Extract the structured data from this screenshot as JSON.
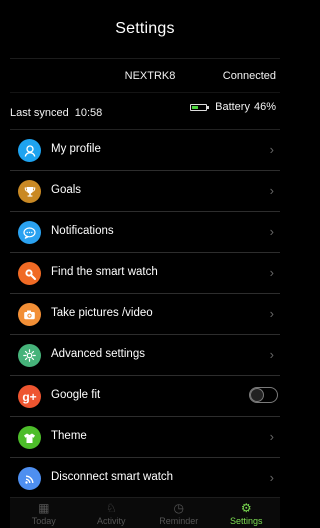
{
  "header": {
    "title": "Settings"
  },
  "device": {
    "name": "NEXTRK8",
    "status": "Connected"
  },
  "sync": {
    "label": "Last synced",
    "time": "10:58"
  },
  "battery": {
    "label": "Battery",
    "value": "46%",
    "level": 0.46
  },
  "menu": {
    "items": [
      {
        "label": "My profile",
        "icon": "profile-icon",
        "color": "#1ea3f0"
      },
      {
        "label": "Goals",
        "icon": "trophy-icon",
        "color": "#c98924"
      },
      {
        "label": "Notifications",
        "icon": "chat-icon",
        "color": "#2aa2f1"
      },
      {
        "label": "Find the smart watch",
        "icon": "search-icon",
        "color": "#f06a24"
      },
      {
        "label": "Take pictures /video",
        "icon": "camera-icon",
        "color": "#f28f36"
      },
      {
        "label": "Advanced settings",
        "icon": "gear-icon",
        "color": "#46b37a"
      },
      {
        "label": "Google fit",
        "icon": "google-plus-icon",
        "color": "#ee5530"
      },
      {
        "label": "Theme",
        "icon": "shirt-icon",
        "color": "#4dbd2a"
      },
      {
        "label": "Disconnect smart watch",
        "icon": "wifi-icon",
        "color": "#4e8ff0"
      }
    ]
  },
  "toggle": {
    "google_fit_enabled": false
  },
  "bottom_nav": {
    "items": [
      {
        "label": "Today",
        "icon": "calendar-icon"
      },
      {
        "label": "Activity",
        "icon": "shoe-icon"
      },
      {
        "label": "Reminder",
        "icon": "clock-icon"
      },
      {
        "label": "Settings",
        "icon": "gear-icon",
        "active": true
      }
    ]
  },
  "colors": {
    "background": "#000000",
    "accent": "#7dde53",
    "text": "#ffffff",
    "muted": "#555555"
  }
}
